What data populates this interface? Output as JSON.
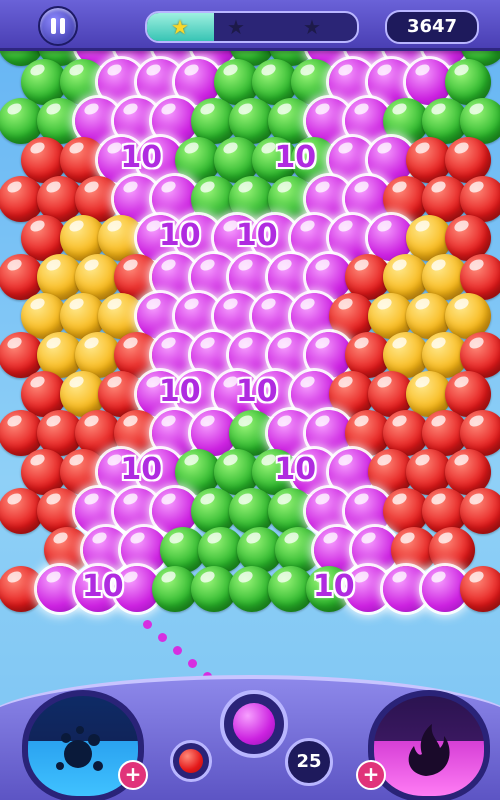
{
  "hud": {
    "pause_icon": "pause-icon",
    "stars_earned": 1,
    "stars_total": 3,
    "progress_fraction": 0.32,
    "score": "3647"
  },
  "colors": {
    "green": "#29b52a",
    "red": "#e4191a",
    "yellow": "#f8b616",
    "purple": "#cc22e0",
    "hud_bg": "#4a3fb4"
  },
  "grid": [
    "GGPPPPGGPPPPG",
    "GGPPPGGGPPPG",
    "GGPPPGGGPPGGG",
    "RRPPGGGGPPRR",
    "RRRPPGGGPPRRR",
    "RYYPPPPPPPYR",
    "RYYRPPPPPRYYR",
    "YYYPPPPPRYYY",
    "RYYRPPPPPRYYR",
    "RYRPPPPPRRYR",
    "RRRRPPGPPRRRR",
    "RRPPGGGPPRRR",
    "RRPPPGGGPPRRR",
    "RPPGGGGPPRR",
    "RPPPGGGGGPPPR"
  ],
  "points": [
    {
      "label": "10",
      "row": 3,
      "col": 2.5
    },
    {
      "label": "10",
      "row": 3,
      "col": 6.5
    },
    {
      "label": "10",
      "row": 5,
      "col": 3.5
    },
    {
      "label": "10",
      "row": 5,
      "col": 5.5
    },
    {
      "label": "10",
      "row": 9,
      "col": 3.5
    },
    {
      "label": "10",
      "row": 9,
      "col": 5.5
    },
    {
      "label": "10",
      "row": 11,
      "col": 2.5
    },
    {
      "label": "10",
      "row": 11,
      "col": 6.5
    },
    {
      "label": "10",
      "row": 14,
      "col": 1.5
    },
    {
      "label": "10",
      "row": 14,
      "col": 7.5
    }
  ],
  "aim_dots": 6,
  "bottom": {
    "left_booster_icon": "splash-bomb-icon",
    "right_booster_icon": "fire-icon",
    "plus_label": "+",
    "shooter_color": "purple",
    "next_color": "red",
    "swap_icon": "swap-arrows-icon",
    "moves_left": "25"
  }
}
